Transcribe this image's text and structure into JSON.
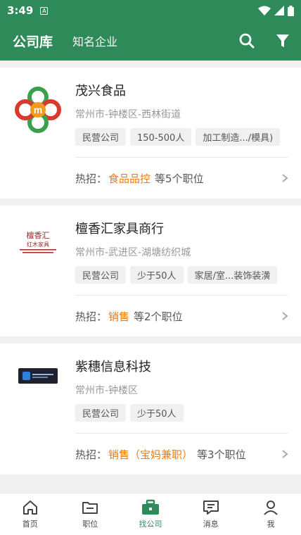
{
  "status_bar": {
    "time": "3:49"
  },
  "header": {
    "title": "公司库",
    "subtitle": "知名企业",
    "icons": [
      "search-icon",
      "filter-icon"
    ]
  },
  "companies": [
    {
      "name": "茂兴食品",
      "address": "常州市-钟楼区-西林街道",
      "tags": [
        "民营公司",
        "150-500人",
        "加工制造.../模具)"
      ],
      "hot_label": "热招：",
      "hot_job": "食品品控",
      "hot_more": "等5个职位",
      "logo": "maoxing-logo"
    },
    {
      "name": "檀香汇家具商行",
      "address": "常州市-武进区-湖塘纺织城",
      "tags": [
        "民营公司",
        "少于50人",
        "家居/室...装饰装潢"
      ],
      "hot_label": "热招：",
      "hot_job": "销售",
      "hot_more": "等2个职位",
      "logo": "tanxianghui-logo",
      "logo_text": {
        "line1": "檀香汇",
        "line2": "红木家具"
      }
    },
    {
      "name": "紫穗信息科技",
      "address": "常州市-钟楼区",
      "tags": [
        "民营公司",
        "少于50人"
      ],
      "hot_label": "热招：",
      "hot_job": "销售（宝妈兼职）",
      "hot_more": "等3个职位",
      "logo": "zisui-logo"
    }
  ],
  "tabbar": {
    "items": [
      {
        "label": "首页",
        "icon": "home-icon",
        "active": false
      },
      {
        "label": "职位",
        "icon": "folder-icon",
        "active": false
      },
      {
        "label": "找公司",
        "icon": "briefcase-icon",
        "active": true
      },
      {
        "label": "消息",
        "icon": "message-icon",
        "active": false
      },
      {
        "label": "我",
        "icon": "person-icon",
        "active": false
      }
    ]
  },
  "colors": {
    "primary": "#2f8a5a",
    "accent": "#f27a0b",
    "muted": "#999999"
  }
}
